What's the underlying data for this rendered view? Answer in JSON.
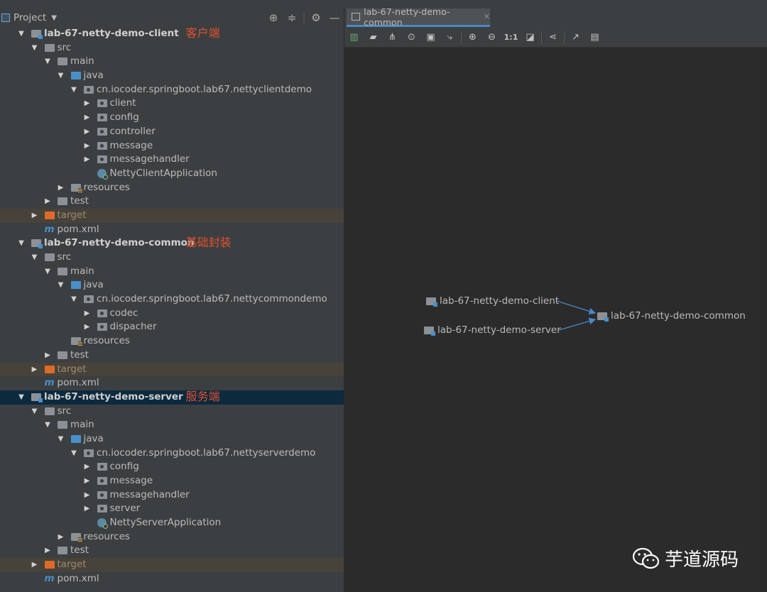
{
  "project_panel": {
    "title": "Project",
    "tools": [
      "locate-icon",
      "collapse-icon",
      "gear-icon",
      "hide-icon"
    ]
  },
  "tree": [
    {
      "depth": 1,
      "arrow": "down",
      "icon": "module",
      "label": "lab-67-netty-demo-client",
      "bold": true,
      "annotation": "客户端"
    },
    {
      "depth": 2,
      "arrow": "down",
      "icon": "folder",
      "label": "src"
    },
    {
      "depth": 3,
      "arrow": "down",
      "icon": "folder",
      "label": "main"
    },
    {
      "depth": 4,
      "arrow": "down",
      "icon": "folder-blue",
      "label": "java"
    },
    {
      "depth": 5,
      "arrow": "down",
      "icon": "package",
      "label": "cn.iocoder.springboot.lab67.nettyclientdemo"
    },
    {
      "depth": 6,
      "arrow": "right",
      "icon": "package",
      "label": "client"
    },
    {
      "depth": 6,
      "arrow": "right",
      "icon": "package",
      "label": "config"
    },
    {
      "depth": 6,
      "arrow": "right",
      "icon": "package",
      "label": "controller"
    },
    {
      "depth": 6,
      "arrow": "right",
      "icon": "package",
      "label": "message"
    },
    {
      "depth": 6,
      "arrow": "right",
      "icon": "package",
      "label": "messagehandler"
    },
    {
      "depth": 6,
      "arrow": "none",
      "icon": "app",
      "label": "NettyClientApplication"
    },
    {
      "depth": 4,
      "arrow": "right",
      "icon": "resources",
      "label": "resources"
    },
    {
      "depth": 3,
      "arrow": "right",
      "icon": "folder",
      "label": "test"
    },
    {
      "depth": 2,
      "arrow": "right",
      "icon": "folder-orange",
      "label": "target",
      "excluded": true
    },
    {
      "depth": 2,
      "arrow": "none",
      "icon": "maven",
      "label": "pom.xml"
    },
    {
      "depth": 1,
      "arrow": "down",
      "icon": "module",
      "label": "lab-67-netty-demo-common",
      "bold": true,
      "annotation": "基础封装"
    },
    {
      "depth": 2,
      "arrow": "down",
      "icon": "folder",
      "label": "src"
    },
    {
      "depth": 3,
      "arrow": "down",
      "icon": "folder",
      "label": "main"
    },
    {
      "depth": 4,
      "arrow": "down",
      "icon": "folder-blue",
      "label": "java"
    },
    {
      "depth": 5,
      "arrow": "down",
      "icon": "package",
      "label": "cn.iocoder.springboot.lab67.nettycommondemo"
    },
    {
      "depth": 6,
      "arrow": "right",
      "icon": "package",
      "label": "codec"
    },
    {
      "depth": 6,
      "arrow": "right",
      "icon": "package",
      "label": "dispacher"
    },
    {
      "depth": 4,
      "arrow": "none",
      "icon": "resources",
      "label": "resources"
    },
    {
      "depth": 3,
      "arrow": "right",
      "icon": "folder",
      "label": "test"
    },
    {
      "depth": 2,
      "arrow": "right",
      "icon": "folder-orange",
      "label": "target",
      "excluded": true
    },
    {
      "depth": 2,
      "arrow": "none",
      "icon": "maven",
      "label": "pom.xml"
    },
    {
      "depth": 1,
      "arrow": "down",
      "icon": "module",
      "label": "lab-67-netty-demo-server",
      "bold": true,
      "annotation": "服务端",
      "selected": true
    },
    {
      "depth": 2,
      "arrow": "down",
      "icon": "folder",
      "label": "src"
    },
    {
      "depth": 3,
      "arrow": "down",
      "icon": "folder",
      "label": "main"
    },
    {
      "depth": 4,
      "arrow": "down",
      "icon": "folder-blue",
      "label": "java"
    },
    {
      "depth": 5,
      "arrow": "down",
      "icon": "package",
      "label": "cn.iocoder.springboot.lab67.nettyserverdemo"
    },
    {
      "depth": 6,
      "arrow": "right",
      "icon": "package",
      "label": "config"
    },
    {
      "depth": 6,
      "arrow": "right",
      "icon": "package",
      "label": "message"
    },
    {
      "depth": 6,
      "arrow": "right",
      "icon": "package",
      "label": "messagehandler"
    },
    {
      "depth": 6,
      "arrow": "right",
      "icon": "package",
      "label": "server"
    },
    {
      "depth": 6,
      "arrow": "none",
      "icon": "app",
      "label": "NettyServerApplication"
    },
    {
      "depth": 4,
      "arrow": "right",
      "icon": "resources",
      "label": "resources"
    },
    {
      "depth": 3,
      "arrow": "right",
      "icon": "folder",
      "label": "test"
    },
    {
      "depth": 2,
      "arrow": "right",
      "icon": "folder-orange",
      "label": "target",
      "excluded": true
    },
    {
      "depth": 2,
      "arrow": "none",
      "icon": "maven",
      "label": "pom.xml"
    }
  ],
  "editor": {
    "tab_label": "lab-67-netty-demo-common",
    "toolbar": [
      "chart-icon",
      "folder-icon",
      "tree-icon",
      "find-icon",
      "fit-icon",
      "route-icon",
      "zoom-in-icon",
      "zoom-out-icon",
      "actual-size-icon",
      "fit-page-icon",
      "layout-icon",
      "export-icon",
      "print-icon"
    ],
    "actual_size_label": "1:1",
    "diagram": {
      "nodes": {
        "client": "lab-67-netty-demo-client",
        "server": "lab-67-netty-demo-server",
        "common": "lab-67-netty-demo-common"
      },
      "edge_color": "#4a88c7"
    }
  },
  "watermark": {
    "text": "芋道源码"
  },
  "colors": {
    "annotation": "#e0512d",
    "selected_row": "#0d293e",
    "excluded_row": "#47433a"
  }
}
